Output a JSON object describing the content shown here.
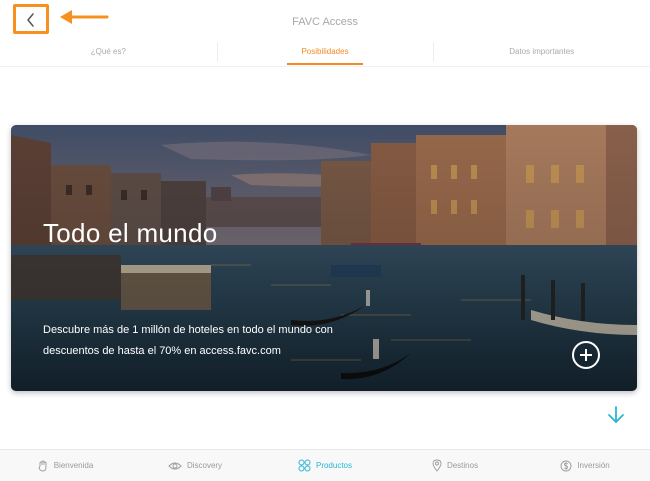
{
  "header": {
    "title": "FAVC Access",
    "back_icon": "chevron-left-icon"
  },
  "tabs": [
    {
      "label": "¿Qué es?",
      "active": false
    },
    {
      "label": "Posibilidades",
      "active": true
    },
    {
      "label": "Datos importantes",
      "active": false
    }
  ],
  "card": {
    "title": "Todo el mundo",
    "description": "Descubre más de 1 millón de hoteles en todo el mundo con descuentos de hasta el 70% en access.favc.com",
    "action_icon": "plus-circle-icon"
  },
  "scroll_icon": "arrow-down-icon",
  "bottom_nav": [
    {
      "label": "Bienvenida",
      "icon": "hand-wave-icon",
      "active": false
    },
    {
      "label": "Discovery",
      "icon": "eye-icon",
      "active": false
    },
    {
      "label": "Productos",
      "icon": "grid-icon",
      "active": true
    },
    {
      "label": "Destinos",
      "icon": "map-pin-icon",
      "active": false
    },
    {
      "label": "Inversión",
      "icon": "dollar-icon",
      "active": false
    }
  ],
  "colors": {
    "accent_orange": "#f28c28",
    "active_nav": "#29b6d5",
    "annotation": "#f7901e"
  }
}
